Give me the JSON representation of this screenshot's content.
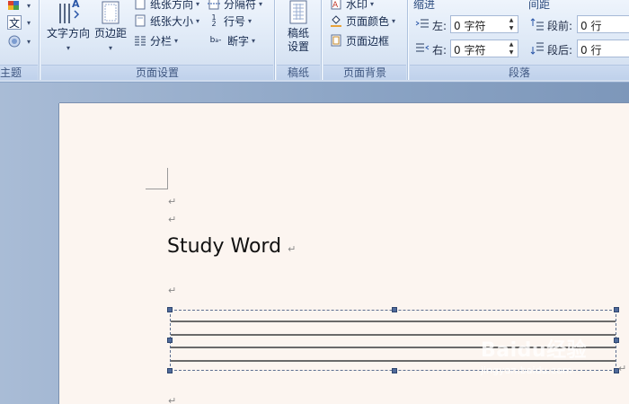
{
  "ribbon": {
    "theme_group": {
      "label": "主题"
    },
    "page_setup": {
      "label": "页面设置",
      "text_direction": "文字方向",
      "margins": "页边距",
      "orientation": "纸张方向",
      "size": "纸张大小",
      "columns": "分栏",
      "breaks": "分隔符",
      "line_numbers": "行号",
      "hyphenation": "断字"
    },
    "manuscript": {
      "label": "稿纸",
      "button_line1": "稿纸",
      "button_line2": "设置"
    },
    "page_background": {
      "label": "页面背景",
      "watermark": "水印",
      "page_color": "页面颜色",
      "page_borders": "页面边框"
    },
    "paragraph": {
      "label": "段落",
      "indent_title": "缩进",
      "indent_left_label": "左:",
      "indent_left_value": "0 字符",
      "indent_right_label": "右:",
      "indent_right_value": "0 字符",
      "spacing_title": "间距",
      "spacing_before_label": "段前:",
      "spacing_before_value": "0 行",
      "spacing_after_label": "段后:",
      "spacing_after_value": "0 行"
    }
  },
  "document": {
    "title": "Study Word",
    "paragraph_mark": "↵"
  },
  "watermark": {
    "logo": "Baidu经验",
    "url": "jingyan.baidu.com"
  },
  "colors": {
    "ribbon_top": "#eef4fc",
    "ribbon_bottom": "#cfdcee",
    "workspace": "#8fa6c6",
    "page": "#fcf5f0"
  }
}
